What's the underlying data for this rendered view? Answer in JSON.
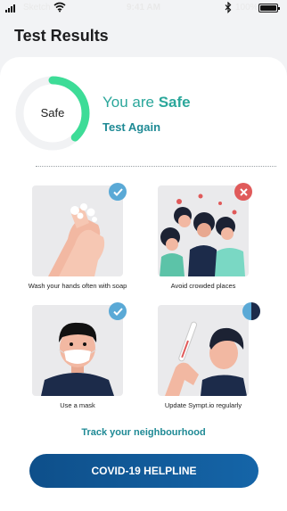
{
  "status_bar": {
    "carrier": "Sketch",
    "time": "9:41 AM",
    "battery": "100%"
  },
  "header": {
    "title": "Test Results"
  },
  "result": {
    "gauge_label": "Safe",
    "gauge_progress": 0.38,
    "status_prefix": "You are ",
    "status_value": "Safe",
    "test_again": "Test Again"
  },
  "tips": [
    {
      "label": "Wash your hands often with soap",
      "badge": "check-icon",
      "done": true
    },
    {
      "label": "Avoid crowded places",
      "badge": "cross-icon",
      "done": false
    },
    {
      "label": "Use a mask",
      "badge": "check-icon",
      "done": true
    },
    {
      "label": "Update Sympt.io regularly",
      "badge": "half-shield-icon",
      "done": null
    }
  ],
  "links": {
    "track": "Track your neighbourhood"
  },
  "buttons": {
    "helpline": "COVID-19 HELPLINE"
  },
  "colors": {
    "accent": "#2ba79b",
    "gauge": "#3ddc97",
    "check_badge": "#5aa9d6",
    "cross_badge": "#e05a5a",
    "button": "#0e4f8a"
  }
}
